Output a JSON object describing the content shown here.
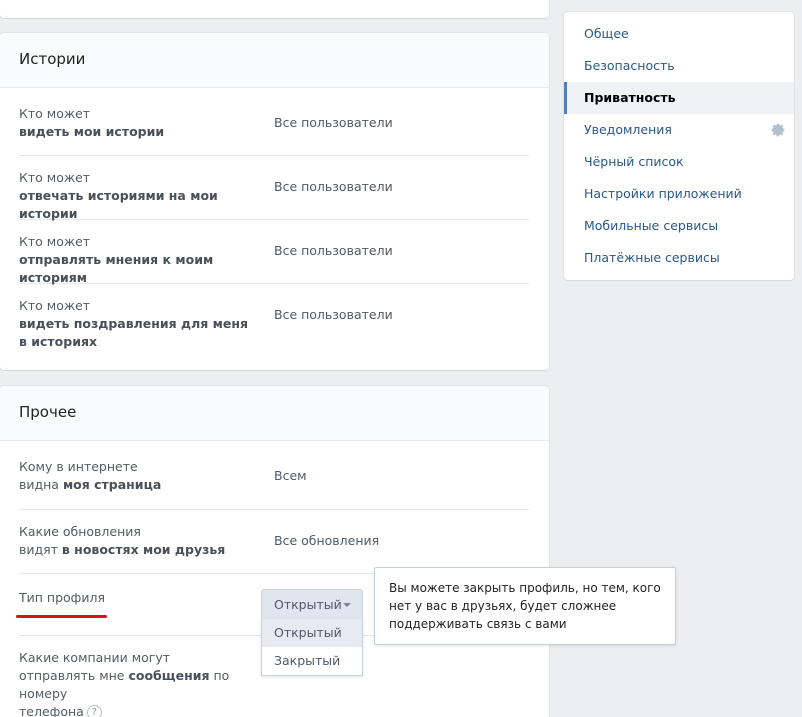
{
  "sections": {
    "stories": {
      "title": "Истории",
      "rows": [
        {
          "line1": "Кто может",
          "line2": "видеть мои истории",
          "value": "Все пользователи"
        },
        {
          "line1": "Кто может",
          "line2": "отвечать историями на мои истории",
          "value": "Все пользователи"
        },
        {
          "line1": "Кто может",
          "line2": "отправлять мнения к моим историям",
          "value": "Все пользователи"
        },
        {
          "line1": "Кто может",
          "line2": "видеть поздравления для меня",
          "line3": "в историях",
          "value": "Все пользователи"
        }
      ]
    },
    "other": {
      "title": "Прочее",
      "rows": [
        {
          "pre": "Кому в интернете",
          "line2_plain": "видна ",
          "line2_bold": "моя страница",
          "value": "Всем"
        },
        {
          "pre": "Какие обновления",
          "line2_plain": "видят ",
          "line2_bold": "в новостях мои друзья",
          "value": "Все обновления"
        }
      ],
      "profile_type": {
        "label": "Тип профиля",
        "selected": "Открытый",
        "options": [
          "Открытый",
          "Закрытый"
        ]
      },
      "companies": {
        "line1": "Какие компании могут",
        "line2_plain": "отправлять мне ",
        "line2_bold": "сообщения",
        "line2_tail": " по номеру",
        "line3": "телефона",
        "help": "?"
      }
    }
  },
  "tooltip": {
    "text": "Вы можете закрыть профиль, но тем, кого нет у вас в друзьях, будет сложнее поддерживать связь с вами"
  },
  "sidebar": {
    "items": [
      {
        "label": "Общее"
      },
      {
        "label": "Безопасность"
      },
      {
        "label": "Приватность",
        "active": true
      },
      {
        "label": "Уведомления",
        "icon": "gear-icon"
      },
      {
        "label": "Чёрный список"
      },
      {
        "label": "Настройки приложений"
      },
      {
        "label": "Мобильные сервисы"
      },
      {
        "label": "Платёжные сервисы"
      }
    ]
  },
  "colors": {
    "accent_red": "#d6131b",
    "link_blue": "#2a5885",
    "active_border": "#5181b8"
  }
}
